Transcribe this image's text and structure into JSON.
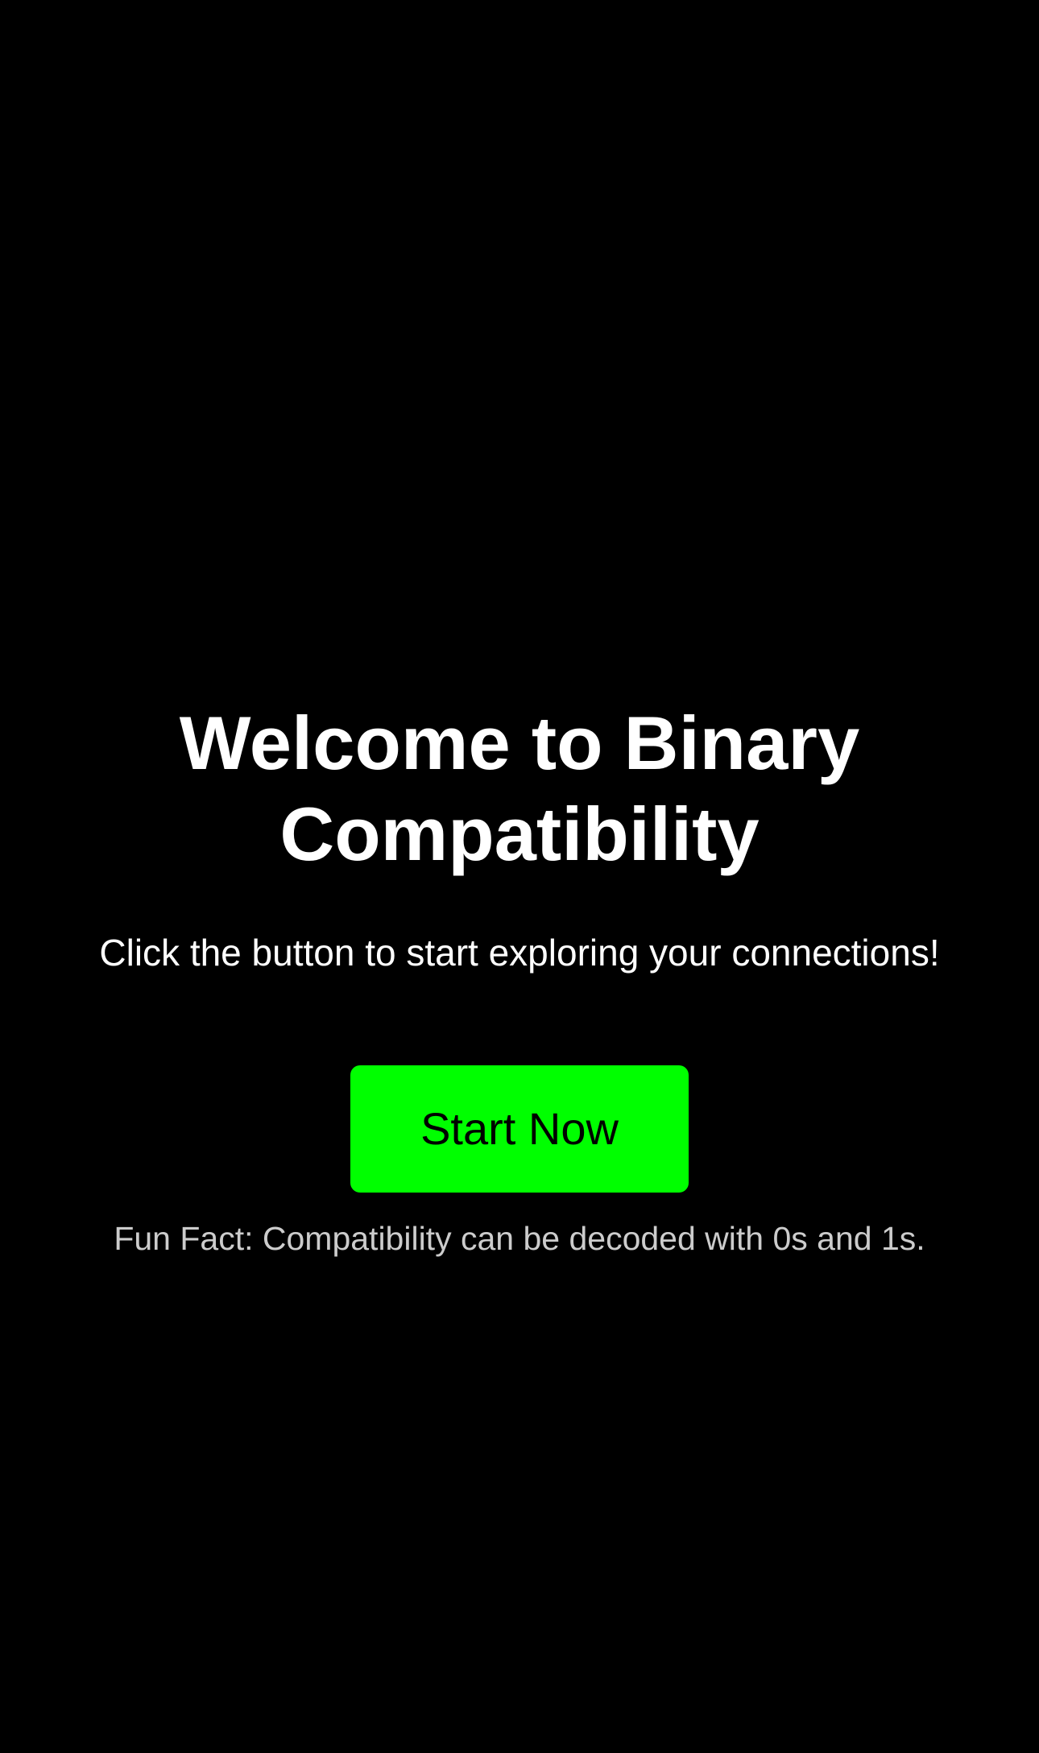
{
  "welcome": {
    "title_line1": "Welcome to Binary",
    "title_line2": "Compatibility",
    "subtitle": "Click the button to start exploring your connections!",
    "start_button_label": "Start Now",
    "fun_fact": "Fun Fact: Compatibility can be decoded with 0s and 1s."
  },
  "colors": {
    "background": "#000000",
    "title_text": "#ffffff",
    "subtitle_text": "#ffffff",
    "button_background": "#00ff00",
    "button_text": "#000000",
    "fun_fact_text": "#cccccc"
  }
}
